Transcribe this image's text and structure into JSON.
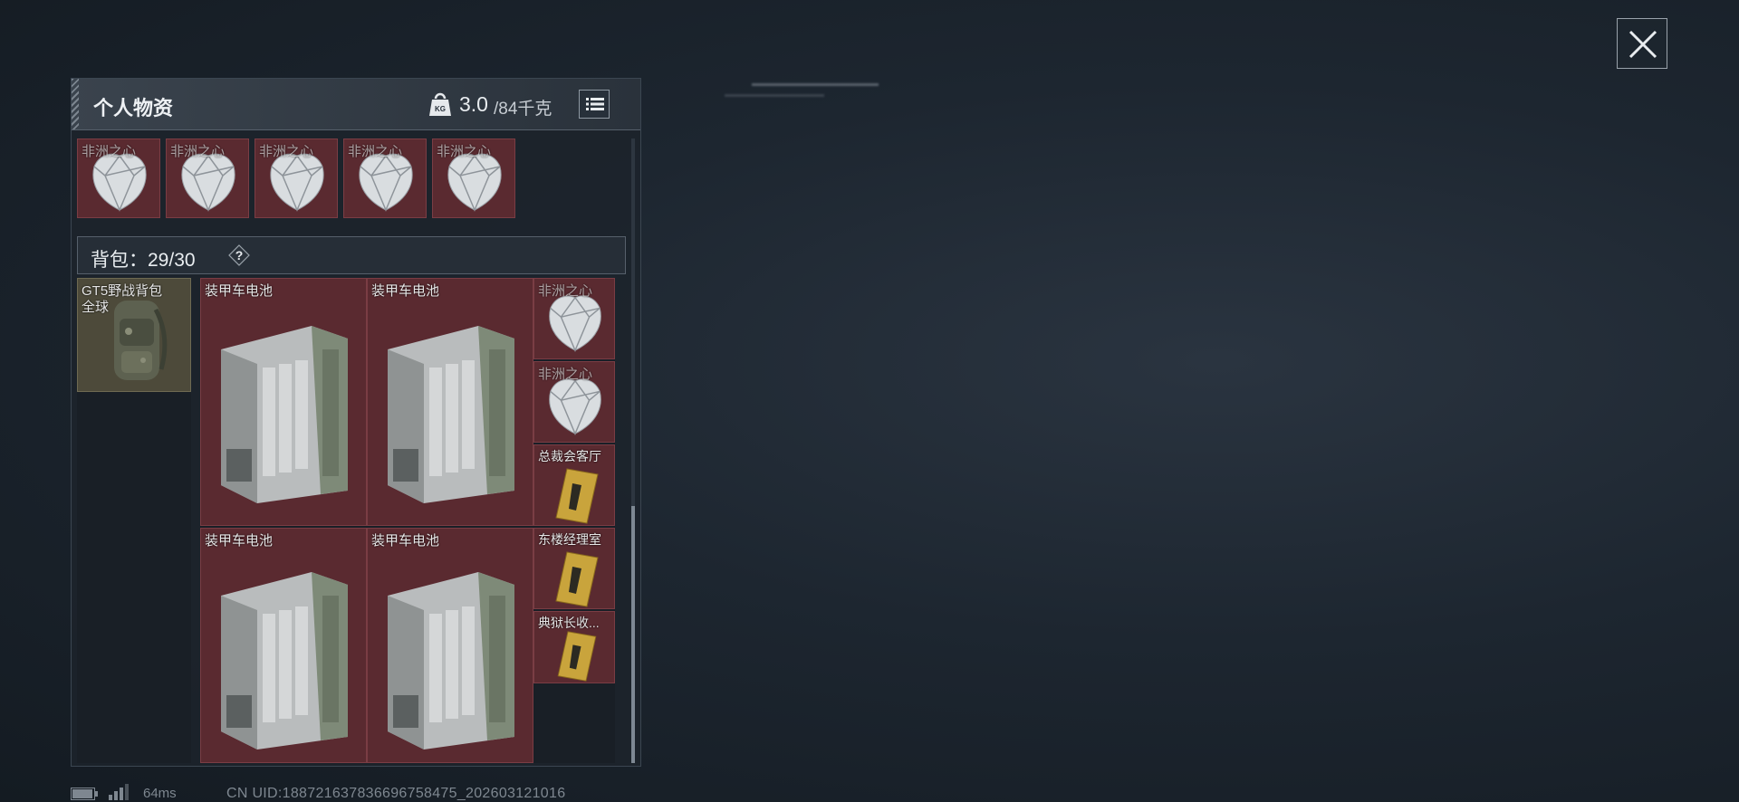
{
  "panel": {
    "title": "个人物资",
    "weight_current": "3.0",
    "weight_max": "/84千克"
  },
  "top_row": {
    "items": [
      {
        "label": "非洲之心"
      },
      {
        "label": "非洲之心"
      },
      {
        "label": "非洲之心"
      },
      {
        "label": "非洲之心"
      },
      {
        "label": "非洲之心"
      }
    ]
  },
  "backpack": {
    "label": "背包：29/30",
    "help": "?",
    "equipped_name": "GT5野战背包",
    "equipped_sub": "全球"
  },
  "grid_items": {
    "battery_1": "装甲车电池",
    "battery_2": "装甲车电池",
    "battery_3": "装甲车电池",
    "battery_4": "装甲车电池",
    "gem_1": "非洲之心",
    "gem_2": "非洲之心",
    "card_1": "总裁会客厅",
    "card_2": "东楼经理室",
    "card_3": "典狱长收..."
  },
  "footer": {
    "ping": "64ms",
    "uid": "CN UID:1887216378366967584​75_202603121016"
  },
  "colors": {
    "slot_bg": "#5a2a30",
    "panel_bg": "#1c232b",
    "backpack_bg": "#4d4a3a"
  }
}
